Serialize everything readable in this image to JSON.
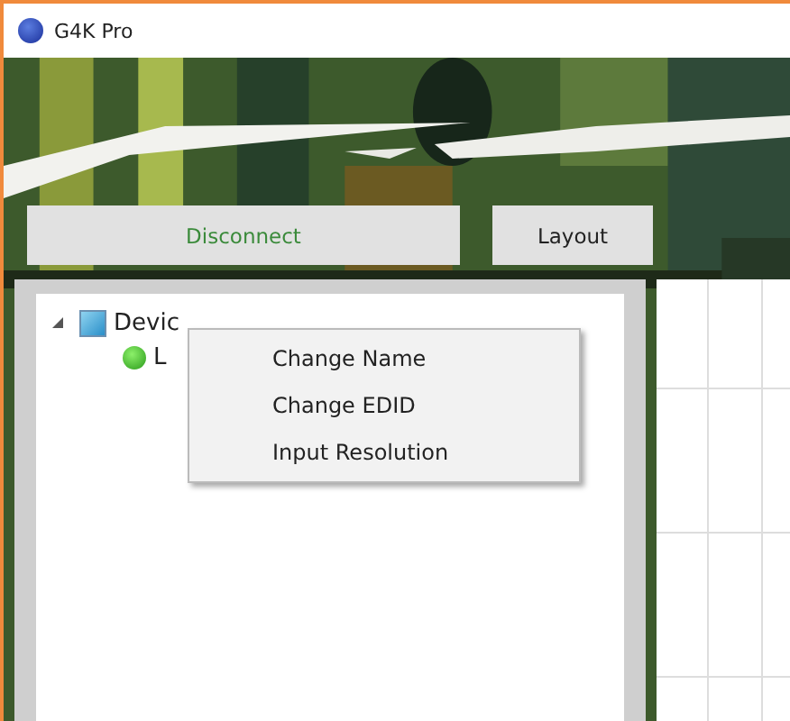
{
  "window": {
    "title": "G4K Pro"
  },
  "buttons": [
    {
      "label": "Disconnect",
      "kind": "primary"
    },
    {
      "label": "Layout",
      "kind": "plain"
    }
  ],
  "tree": [
    {
      "label": "Devic",
      "expanded": true,
      "children": [
        {
          "label": "L"
        }
      ]
    }
  ],
  "context_menu": {
    "items": [
      {
        "label": "Change Name"
      },
      {
        "label": "Change EDID"
      },
      {
        "label": "Input Resolution"
      }
    ]
  }
}
